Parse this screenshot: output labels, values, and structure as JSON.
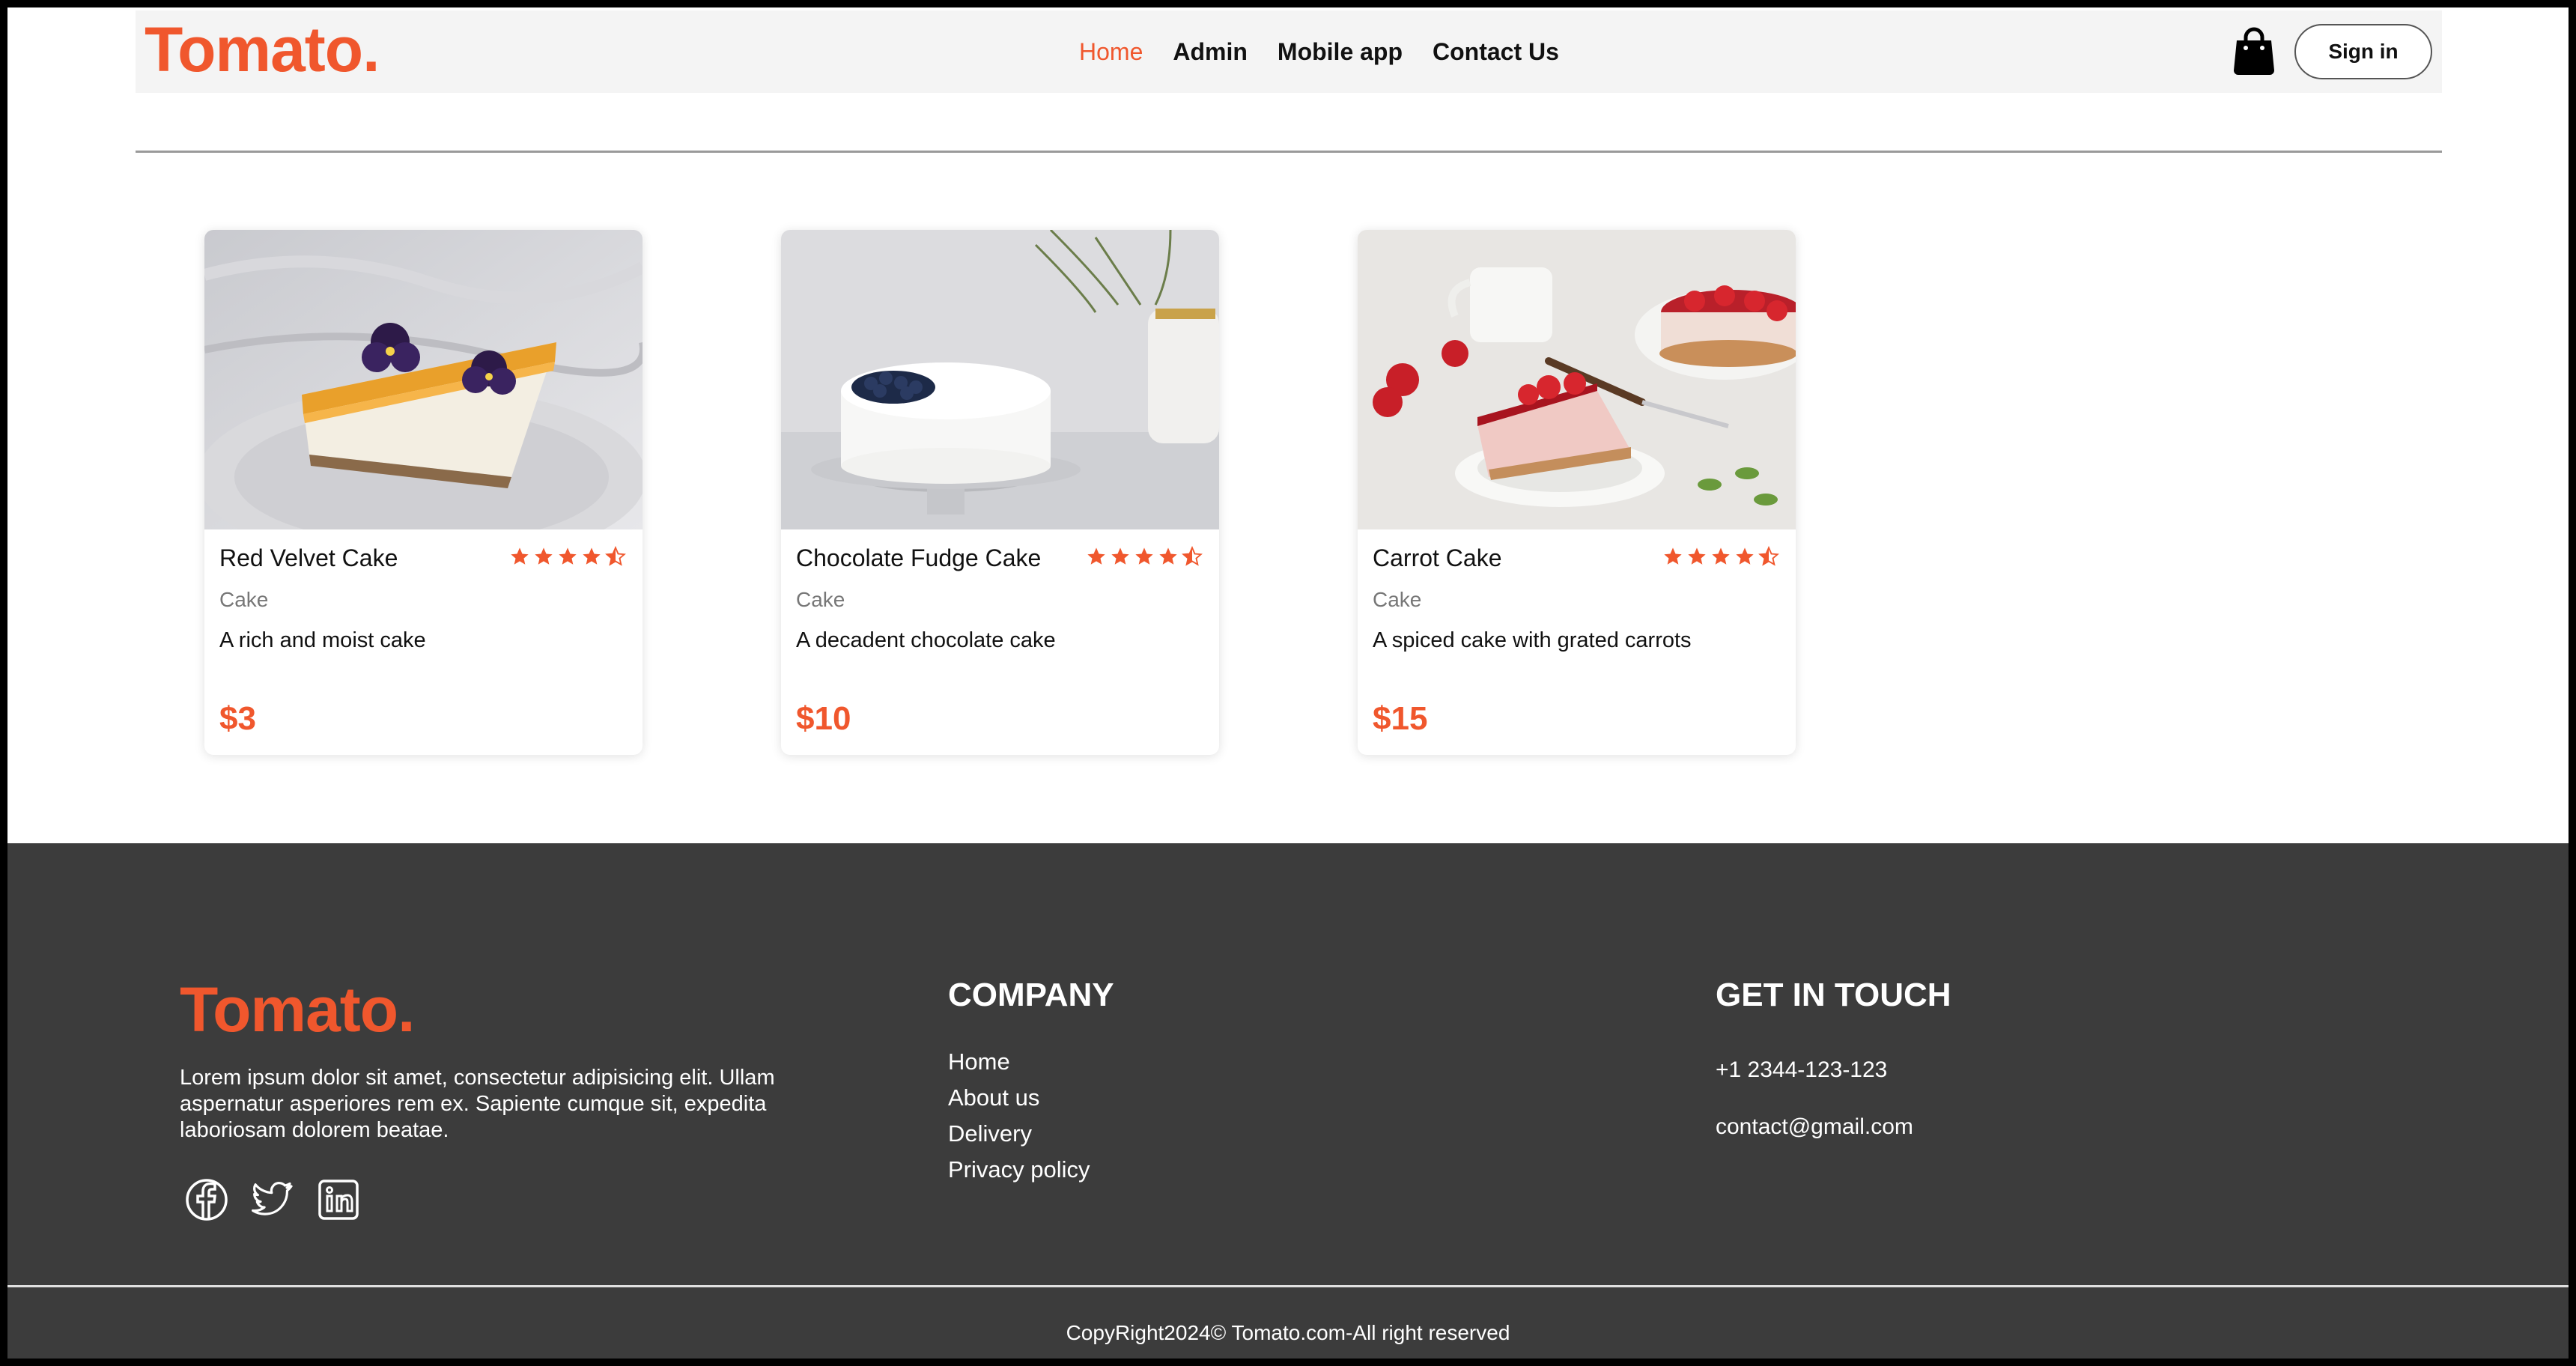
{
  "brand": {
    "logo": "Tomato.",
    "accent": "#f0572d"
  },
  "nav": {
    "links": [
      "Home",
      "Admin",
      "Mobile app",
      "Contact Us"
    ],
    "active": "Home",
    "sign_in": "Sign in",
    "cart_icon": "shopping-bag-icon"
  },
  "products": [
    {
      "name": "Red Velvet Cake",
      "category": "Cake",
      "description": "A rich and moist cake",
      "price": "$3",
      "rating": 4.5
    },
    {
      "name": "Chocolate Fudge Cake",
      "category": "Cake",
      "description": "A decadent chocolate cake",
      "price": "$10",
      "rating": 4.5
    },
    {
      "name": "Carrot Cake",
      "category": "Cake",
      "description": "A spiced cake with grated carrots",
      "price": "$15",
      "rating": 4.5
    }
  ],
  "footer": {
    "logo": "Tomato.",
    "about": "Lorem ipsum dolor sit amet, consectetur adipisicing elit. Ullam aspernatur asperiores rem ex. Sapiente cumque sit, expedita laboriosam dolorem beatae.",
    "socials": [
      "facebook-icon",
      "twitter-icon",
      "linkedin-icon"
    ],
    "company_title": "COMPANY",
    "company_links": [
      "Home",
      "About us",
      "Delivery",
      "Privacy policy"
    ],
    "contact_title": "GET IN TOUCH",
    "phone": "+1 2344-123-123",
    "email": "contact@gmail.com",
    "copyright": "CopyRight2024© Tomato.com-All right reserved"
  }
}
